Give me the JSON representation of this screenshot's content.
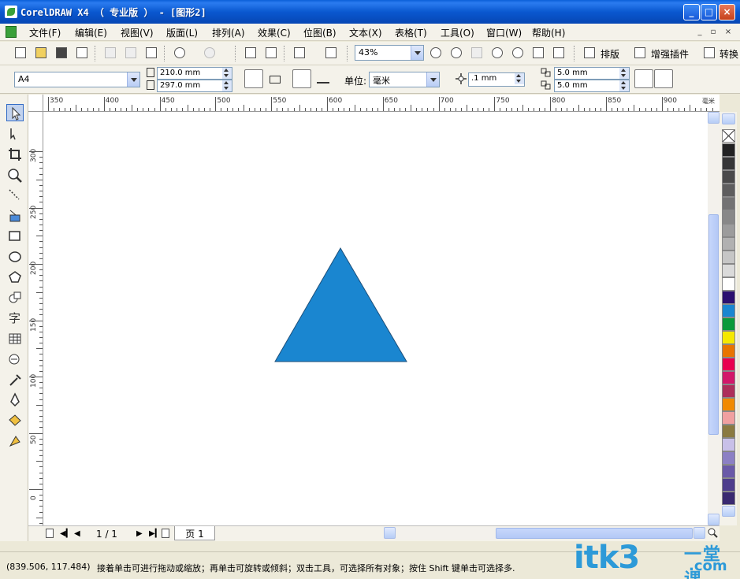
{
  "window": {
    "title": "CorelDRAW X4 （ 专业版 ） - [图形2]",
    "buttons": [
      "_",
      "□",
      "×"
    ]
  },
  "menubar": {
    "items": [
      "文件(F)",
      "编辑(E)",
      "视图(V)",
      "版面(L)",
      "排列(A)",
      "效果(C)",
      "位图(B)",
      "文本(X)",
      "表格(T)",
      "工具(O)",
      "窗口(W)",
      "帮助(H)"
    ],
    "doc_controls": [
      "_",
      "▫",
      "×"
    ]
  },
  "toolbar": {
    "zoom": "43%",
    "button_paiban": "排版",
    "button_zengqiang": "增强插件",
    "button_zhuanhuan": "转换"
  },
  "propertybar": {
    "paper_size": "A4",
    "width": "210.0 mm",
    "height": "297.0 mm",
    "units_label": "单位:",
    "units_value": "毫米",
    "nudge": ".1 mm",
    "dup_x": "5.0 mm",
    "dup_y": "5.0 mm"
  },
  "ruler": {
    "horizontal_labels": [
      "350",
      "400",
      "450",
      "500",
      "550",
      "600",
      "650",
      "700",
      "750",
      "800",
      "850",
      "900"
    ],
    "horizontal_unit": "毫米",
    "vertical_labels": [
      "300",
      "250",
      "200",
      "150",
      "100",
      "50",
      "0"
    ]
  },
  "canvas": {
    "shape": "triangle",
    "fill_color": "#1a86d0",
    "stroke_color": "#1d4f7a"
  },
  "pagenav": {
    "page_count": "1 / 1",
    "page_tab": "页 1"
  },
  "palette": {
    "colors": [
      "#222222",
      "#363636",
      "#4a4a4a",
      "#5e5e5e",
      "#737373",
      "#888888",
      "#9c9c9c",
      "#b1b1b1",
      "#c6c6c6",
      "#dadada",
      "#ffffff",
      "#2b1070",
      "#1a86d0",
      "#0a9a3a",
      "#f5e800",
      "#e87400",
      "#e8004e",
      "#d2186a",
      "#ad2f5a",
      "#f08a00",
      "#f0a0a0",
      "#8a7a40",
      "#c8c0e8",
      "#8c80c4",
      "#6a5aa8",
      "#4e3e8c",
      "#3a2a70"
    ]
  },
  "statusbar": {
    "coords": "(839.506, 117.484)",
    "message": "接着单击可进行拖动或缩放；再单击可旋转或倾斜；双击工具，可选择所有对象；按住 Shift 键单击可选择多."
  },
  "watermark": {
    "text": "itk3",
    "cn": "一堂课",
    "com": ".com"
  }
}
